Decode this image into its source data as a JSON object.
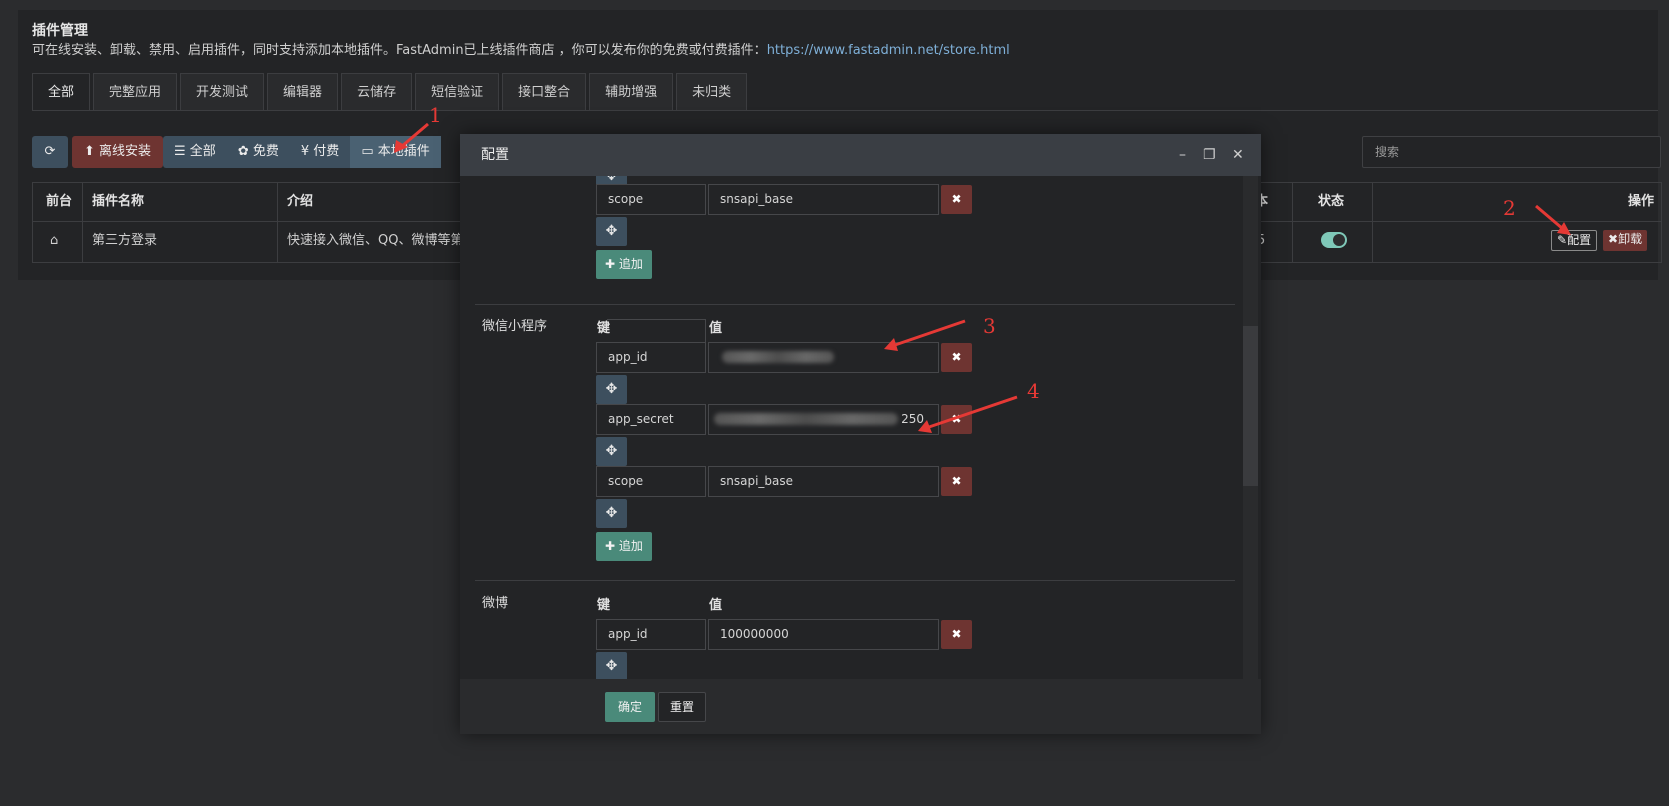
{
  "page": {
    "title": "插件管理",
    "description": "可在线安装、卸载、禁用、启用插件，同时支持添加本地插件。FastAdmin已上线插件商店 ，你可以发布你的免费或付费插件：",
    "store_link": "https://www.fastadmin.net/store.html"
  },
  "tabs": [
    "全部",
    "完整应用",
    "开发测试",
    "编辑器",
    "云储存",
    "短信验证",
    "接口整合",
    "辅助增强",
    "未归类"
  ],
  "toolbar": {
    "offline_install": "离线安装",
    "filter_all": "全部",
    "filter_free": "免费",
    "filter_paid": "付费",
    "filter_local": "本地插件",
    "search_placeholder": "搜索"
  },
  "table": {
    "headers": {
      "frontend": "前台",
      "name": "插件名称",
      "intro": "介绍",
      "version_partial": "本",
      "status": "状态",
      "actions": "操作"
    },
    "row": {
      "name": "第三方登录",
      "intro": "快速接入微信、QQ、微博等第",
      "version_partial": "5",
      "status_on": true,
      "config_label": "配置",
      "uninstall_label": "卸载"
    }
  },
  "modal": {
    "title": "配置",
    "key_label": "键",
    "value_label": "值",
    "add_label": "追加",
    "sections": {
      "top": {
        "key": "scope",
        "value": "snsapi_base"
      },
      "miniprogram": {
        "title": "微信小程序",
        "rows": [
          {
            "key": "app_id",
            "value": ""
          },
          {
            "key": "app_secret",
            "value": "250"
          },
          {
            "key": "scope",
            "value": "snsapi_base"
          }
        ]
      },
      "weibo": {
        "title": "微博",
        "rows": [
          {
            "key": "app_id",
            "value": "100000000"
          }
        ]
      }
    },
    "confirm_label": "确定",
    "reset_label": "重置"
  },
  "annotations": [
    "1",
    "2",
    "3",
    "4"
  ],
  "colors": {
    "annotation": "#e53935",
    "danger": "#6e3431",
    "primary": "#3d4f5e",
    "success": "#4a8a7a"
  }
}
